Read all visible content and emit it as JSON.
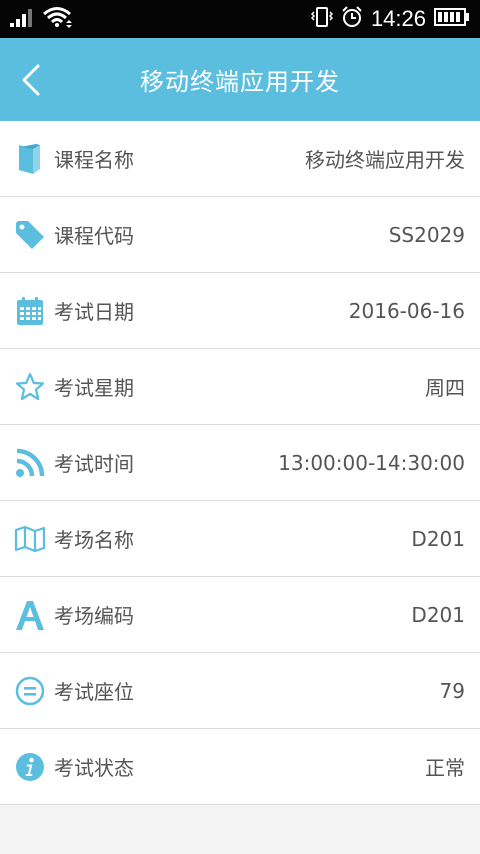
{
  "status_bar": {
    "time": "14:26",
    "icons": [
      "signal-icon",
      "wifi-icon",
      "vibrate-icon",
      "alarm-icon",
      "battery-icon"
    ]
  },
  "header": {
    "title": "移动终端应用开发",
    "back_icon": "chevron-left-icon",
    "color": "#5bbedf"
  },
  "rows": [
    {
      "icon": "book-icon",
      "label": "课程名称",
      "value": "移动终端应用开发"
    },
    {
      "icon": "tag-icon",
      "label": "课程代码",
      "value": "SS2029"
    },
    {
      "icon": "calendar-icon",
      "label": "考试日期",
      "value": "2016-06-16"
    },
    {
      "icon": "star-icon",
      "label": "考试星期",
      "value": "周四"
    },
    {
      "icon": "rss-icon",
      "label": "考试时间",
      "value": "13:00:00-14:30:00"
    },
    {
      "icon": "map-icon",
      "label": "考场名称",
      "value": "D201"
    },
    {
      "icon": "letter-a-icon",
      "label": "考场编码",
      "value": "D201"
    },
    {
      "icon": "equals-circle-icon",
      "label": "考试座位",
      "value": "79"
    },
    {
      "icon": "info-icon",
      "label": "考试状态",
      "value": "正常"
    }
  ],
  "icon_color": "#5bbedf"
}
